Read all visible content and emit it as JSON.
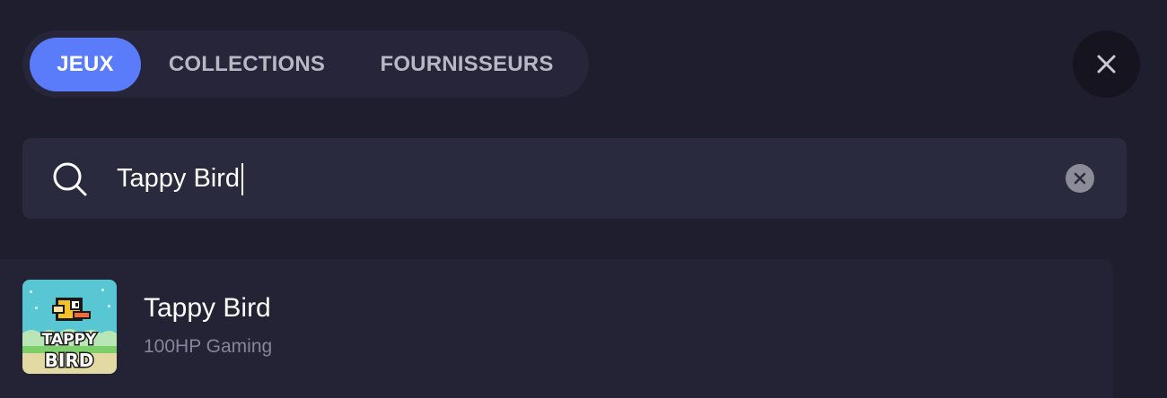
{
  "tabs": [
    {
      "label": "JEUX",
      "active": true
    },
    {
      "label": "COLLECTIONS",
      "active": false
    },
    {
      "label": "FOURNISSEURS",
      "active": false
    }
  ],
  "search": {
    "value": "Tappy Bird",
    "icon": "search-icon",
    "clear_icon": "clear-icon"
  },
  "close": {
    "icon": "close-icon"
  },
  "results": [
    {
      "title": "Tappy Bird",
      "provider": "100HP Gaming",
      "thumbnail_text": [
        "TAPPY",
        "BIRD"
      ]
    }
  ],
  "colors": {
    "background": "#1f1e2f",
    "accent": "#5b7cfa",
    "panel": "#2a2a3e",
    "result_bg": "#242336"
  }
}
